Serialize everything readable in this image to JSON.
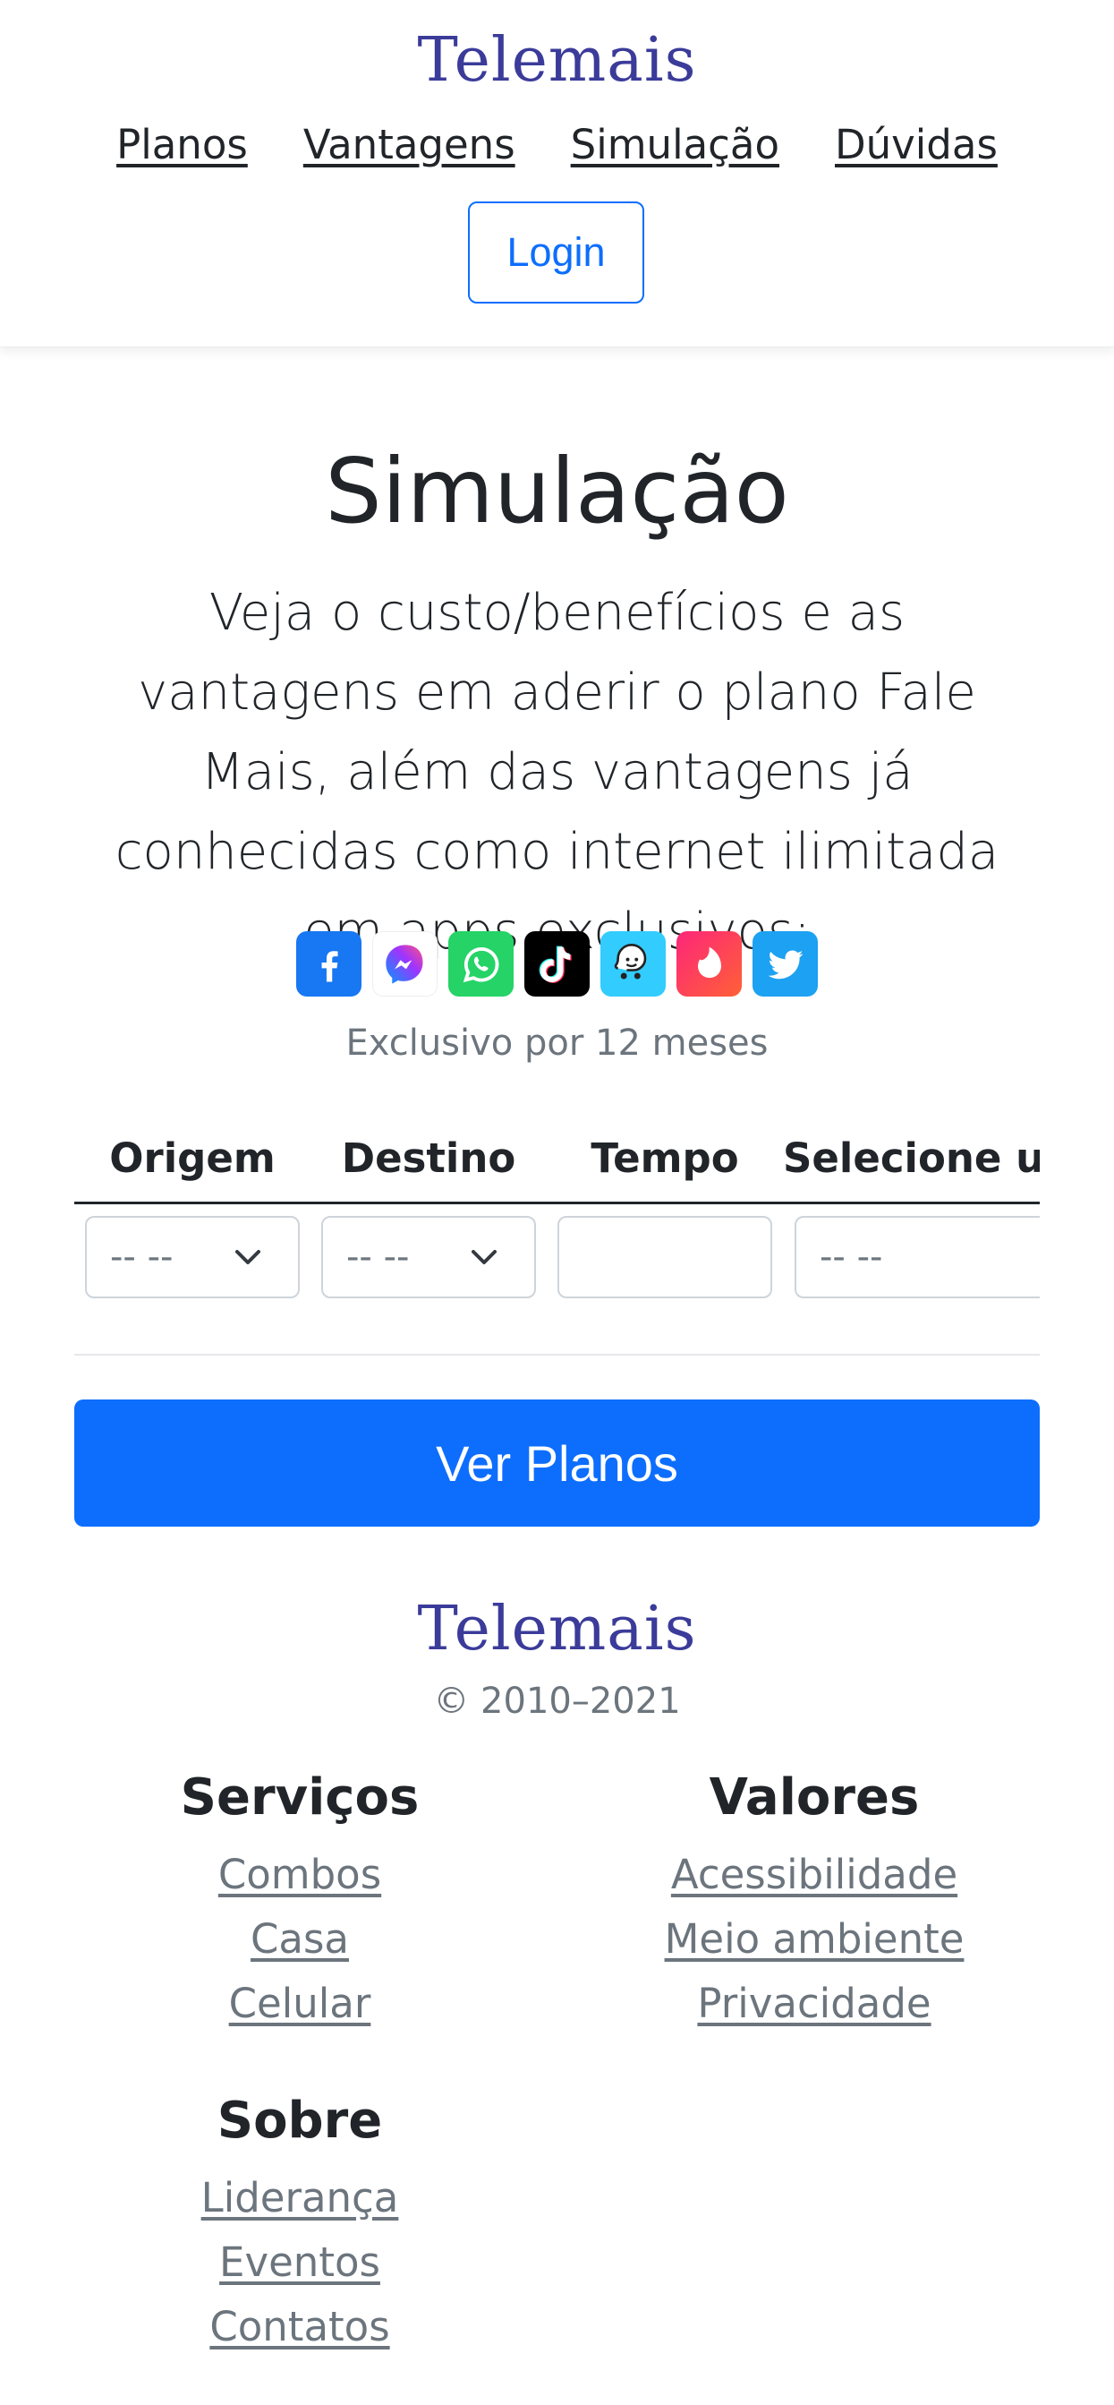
{
  "header": {
    "brand": "Telemais",
    "nav": [
      "Planos",
      "Vantagens",
      "Simulação",
      "Dúvidas"
    ],
    "login_label": "Login"
  },
  "main": {
    "title": "Simulação",
    "lead": "Veja o custo/benefícios e as vantagens em aderir o plano Fale Mais, além das vantagens já conhecidas como internet ilimitada em apps exclusivos:",
    "apps": [
      {
        "name": "facebook-icon",
        "color": "#1877f2"
      },
      {
        "name": "messenger-icon",
        "color": "#ffffff"
      },
      {
        "name": "whatsapp-icon",
        "color": "#25d366"
      },
      {
        "name": "tiktok-icon",
        "color": "#000000"
      },
      {
        "name": "waze-icon",
        "color": "#33ccff"
      },
      {
        "name": "tinder-icon",
        "color": "#fe3c72"
      },
      {
        "name": "twitter-icon",
        "color": "#1da1f2"
      }
    ],
    "apps_note": "Exclusivo por 12 meses",
    "table": {
      "headers": [
        "Origem",
        "Destino",
        "Tempo",
        "Selecione um plano"
      ],
      "origem_value": "-- --",
      "destino_value": "-- --",
      "tempo_value": "",
      "plano_value": "-- --"
    },
    "cta_label": "Ver Planos"
  },
  "footer": {
    "brand": "Telemais",
    "copyright": "© 2010–2021",
    "servicos": {
      "title": "Serviços",
      "links": [
        "Combos",
        "Casa",
        "Celular"
      ]
    },
    "valores": {
      "title": "Valores",
      "links": [
        "Acessibilidade",
        "Meio ambiente",
        "Privacidade"
      ]
    },
    "sobre": {
      "title": "Sobre",
      "links": [
        "Liderança",
        "Eventos",
        "Contatos"
      ]
    }
  },
  "colors": {
    "primary": "#0d6efd",
    "brand": "#3b3b9a",
    "muted": "#6c757d"
  }
}
